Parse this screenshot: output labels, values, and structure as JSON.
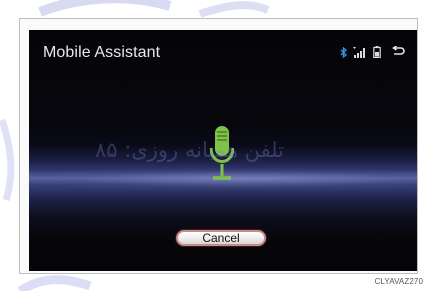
{
  "screen": {
    "title": "Mobile Assistant",
    "status_icons": [
      "bluetooth-icon",
      "signal-icon",
      "battery-icon",
      "back-icon"
    ],
    "mic_icon": "microphone-icon",
    "cancel_label": "Cancel"
  },
  "caption": "CLYAVAZ270",
  "watermark": {
    "text": "تلفن همبانه روزی: ۸۵",
    "logo": "watermark-logo"
  },
  "colors": {
    "mic_green": "#7fc24a",
    "title_text": "#e9e9e9",
    "button_border": "#c98a8a"
  }
}
